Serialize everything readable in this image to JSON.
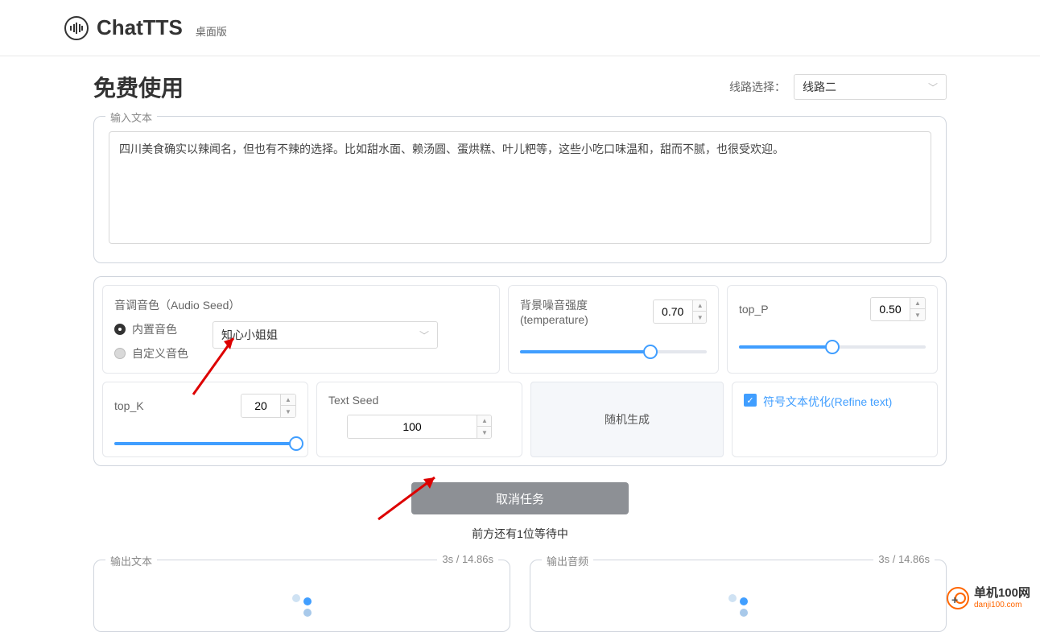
{
  "header": {
    "title": "ChatTTS",
    "subtitle": "桌面版"
  },
  "page": {
    "title": "免费使用"
  },
  "route": {
    "label": "线路选择：",
    "value": "线路二"
  },
  "input": {
    "legend": "输入文本",
    "value": "四川美食确实以辣闻名，但也有不辣的选择。比如甜水面、赖汤圆、蛋烘糕、叶儿粑等，这些小吃口味温和，甜而不腻，也很受欢迎。"
  },
  "audio_seed": {
    "label": "音调音色（Audio Seed）",
    "radio_builtin": "内置音色",
    "radio_custom": "自定义音色",
    "preset": "知心小姐姐"
  },
  "temperature": {
    "label": "背景噪音强度(temperature)",
    "value": "0.70",
    "slider_pct": 70
  },
  "top_p": {
    "label": "top_P",
    "value": "0.50",
    "slider_pct": 50
  },
  "top_k": {
    "label": "top_K",
    "value": "20",
    "slider_pct": 100
  },
  "text_seed": {
    "label": "Text Seed",
    "value": "100"
  },
  "random_btn": "随机生成",
  "refine": {
    "label": "符号文本优化(Refine text)",
    "checked": true
  },
  "cancel_btn": "取消任务",
  "status": "前方还有1位等待中",
  "outputs": {
    "text": {
      "legend": "输出文本",
      "time": "3s / 14.86s"
    },
    "audio": {
      "legend": "输出音频",
      "time": "3s / 14.86s"
    }
  },
  "watermark": {
    "cn": "单机100网",
    "en": "danji100.com"
  }
}
